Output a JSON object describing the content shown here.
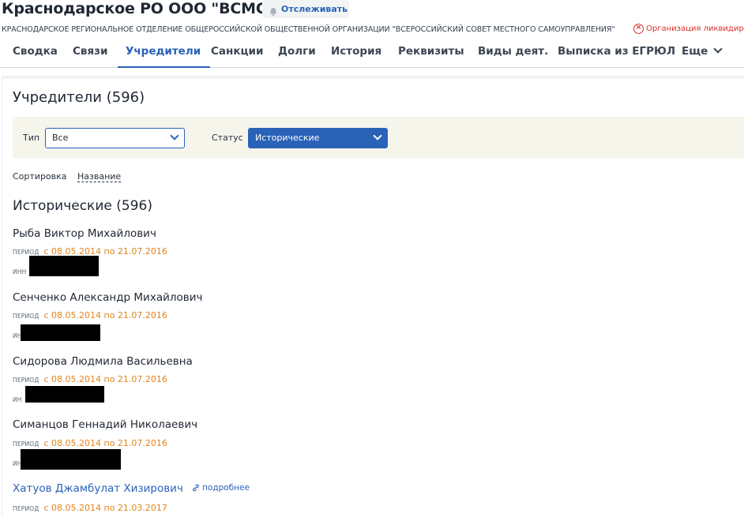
{
  "header": {
    "title": "Краснодарское РО ООО \"ВСМС\"",
    "follow_label": "Отслеживать",
    "full_name": "КРАСНОДАРСКОЕ РЕГИОНАЛЬНОЕ ОТДЕЛЕНИЕ ОБЩЕРОССИЙСКОЙ ОБЩЕСТВЕННОЙ ОРГАНИЗАЦИИ \"ВСЕРОССИЙСКИЙ СОВЕТ МЕСТНОГО САМОУПРАВЛЕНИЯ\"",
    "status_text": "Организация ликвидирова"
  },
  "tabs": [
    {
      "label": "Сводка"
    },
    {
      "label": "Связи"
    },
    {
      "label": "Учредители",
      "active": true
    },
    {
      "label": "Санкции"
    },
    {
      "label": "Долги"
    },
    {
      "label": "История"
    },
    {
      "label": "Реквизиты"
    },
    {
      "label": "Виды деят."
    },
    {
      "label": "Выписка из ЕГРЮЛ"
    },
    {
      "label": "Еще"
    }
  ],
  "founders": {
    "title": "Учредители (596)",
    "filters": {
      "type_label": "Тип",
      "type_value": "Все",
      "status_label": "Статус",
      "status_value": "Исторические"
    },
    "sort_label": "Сортировка",
    "sort_value": "Название",
    "group_title": "Исторические (596)",
    "period_key": "период",
    "inn_key": "инн",
    "entries": [
      {
        "name": "Рыба Виктор Михайлович",
        "period": "с 08.05.2014 по 21.07.2016",
        "inn_visible": "ИНН"
      },
      {
        "name": "Сенченко Александр Михайлович",
        "period": "с 08.05.2014 по 21.07.2016",
        "inn_visible": "ИН"
      },
      {
        "name": "Сидорова Людмила Васильевна",
        "period": "с 08.05.2014 по 21.07.2016",
        "inn_visible": "ИН"
      },
      {
        "name": "Симанцов Геннадий Николаевич",
        "period": "с 08.05.2014 по 21.07.2016",
        "inn_visible": "ИН"
      },
      {
        "name": "Хатуов Джамбулат Хизирович",
        "period": "с 08.05.2014 по 21.03.2017",
        "more_label": "подробнее"
      }
    ]
  },
  "colors": {
    "accent": "#2a62b8",
    "period": "#e2841a",
    "danger": "#d9302a",
    "filter_bg": "#f6f5ec"
  }
}
